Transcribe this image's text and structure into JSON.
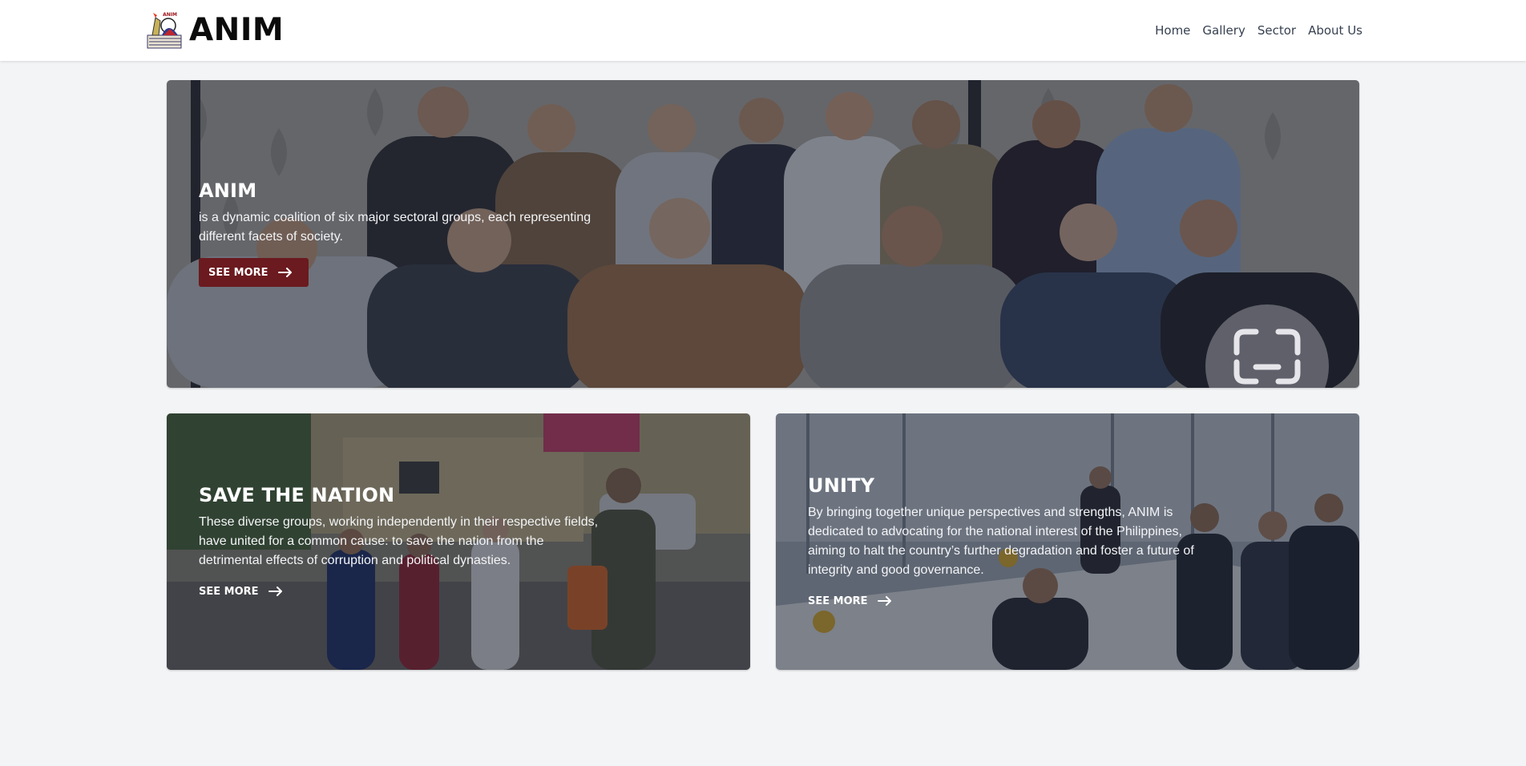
{
  "header": {
    "brand": "ANIM",
    "logo_icon": "anim-logo-icon",
    "nav": [
      "Home",
      "Gallery",
      "Sector",
      "About Us"
    ]
  },
  "hero": {
    "title": "ANIM",
    "description": "is a dynamic coalition of six major sectoral groups, each representing different facets of society.",
    "button_label": "SEE MORE",
    "button_icon": "arrow-right-icon",
    "accent": "#6b1a1f"
  },
  "cards": [
    {
      "title": "SAVE THE NATION",
      "description": "These diverse groups, working independently in their respective fields, have united for a common cause: to save the nation from the detrimental effects of corruption and political dynasties.",
      "link_label": "SEE MORE"
    },
    {
      "title": "UNITY",
      "description": "By bringing together unique perspectives and strengths, ANIM is dedicated to advocating for the national interest of the Philippines, aiming to halt the country’s further degradation and foster a future of integrity and good governance.",
      "link_label": "SEE MORE"
    }
  ],
  "colors": {
    "page_background": "#f3f4f6",
    "header_background": "#ffffff",
    "button_maroon": "#6b1a1f",
    "overlay": "rgba(25,30,45,0.52)"
  }
}
